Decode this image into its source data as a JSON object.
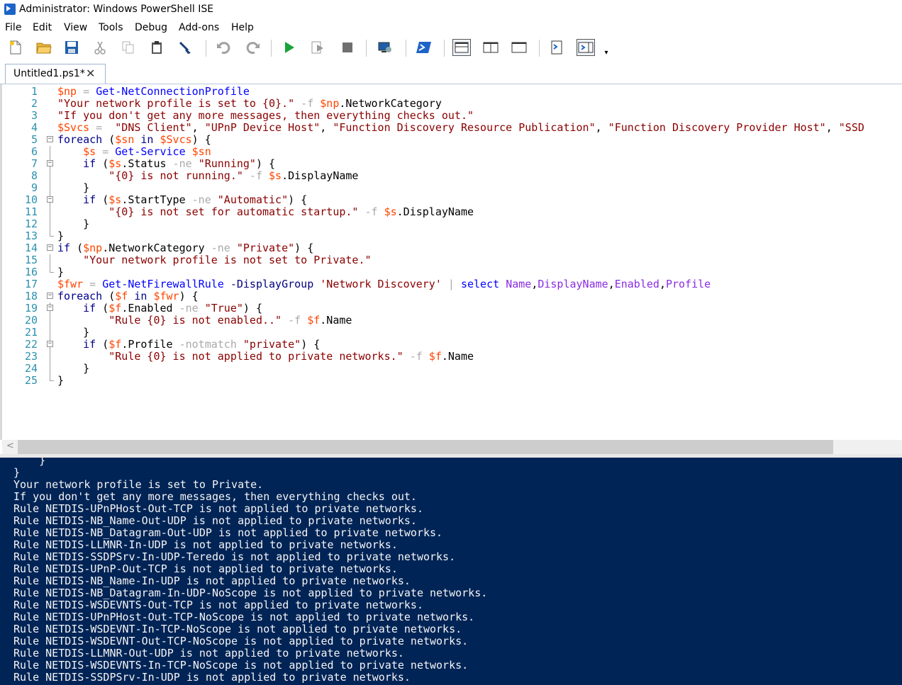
{
  "window": {
    "title": "Administrator: Windows PowerShell ISE"
  },
  "menu": [
    "File",
    "Edit",
    "View",
    "Tools",
    "Debug",
    "Add-ons",
    "Help"
  ],
  "toolbar": {
    "buttons": [
      "new-script",
      "open",
      "save",
      "cut",
      "copy",
      "paste",
      "clear-console",
      "undo",
      "redo",
      "run-script",
      "run-selection",
      "stop",
      "new-remote-tab",
      "start-powershell",
      "show-script-pane-top",
      "show-script-pane-right",
      "show-script-pane-maximized",
      "show-command-window",
      "show-command-add-on"
    ]
  },
  "tab": {
    "label": "Untitled1.ps1*",
    "close": "✕"
  },
  "editor": {
    "lines": [
      [
        [
          "$np",
          "var"
        ],
        [
          " = ",
          "op"
        ],
        [
          "Get-NetConnectionProfile",
          "cmd"
        ]
      ],
      [
        [
          "\"Your network profile is set to {0}.\"",
          "str"
        ],
        [
          " -f ",
          "op"
        ],
        [
          "$np",
          "var"
        ],
        [
          ".NetworkCategory",
          "mem"
        ]
      ],
      [
        [
          "\"If you don't get any more messages, then everything checks out.\"",
          "str"
        ]
      ],
      [
        [
          "$Svcs",
          "var"
        ],
        [
          " =  ",
          "op"
        ],
        [
          "\"DNS Client\"",
          "str"
        ],
        [
          ", ",
          "par"
        ],
        [
          "\"UPnP Device Host\"",
          "str"
        ],
        [
          ", ",
          "par"
        ],
        [
          "\"Function Discovery Resource Publication\"",
          "str"
        ],
        [
          ", ",
          "par"
        ],
        [
          "\"Function Discovery Provider Host\"",
          "str"
        ],
        [
          ", ",
          "par"
        ],
        [
          "\"SSD",
          "str"
        ]
      ],
      [
        [
          "foreach",
          "kw"
        ],
        [
          " (",
          "par"
        ],
        [
          "$sn",
          "var"
        ],
        [
          " in ",
          "kw"
        ],
        [
          "$Svcs",
          "var"
        ],
        [
          ") {",
          "par"
        ]
      ],
      [
        [
          "    ",
          "plain"
        ],
        [
          "$s",
          "var"
        ],
        [
          " = ",
          "op"
        ],
        [
          "Get-Service",
          "cmd"
        ],
        [
          " ",
          "plain"
        ],
        [
          "$sn",
          "var"
        ]
      ],
      [
        [
          "    ",
          "plain"
        ],
        [
          "if",
          "kw"
        ],
        [
          " (",
          "par"
        ],
        [
          "$s",
          "var"
        ],
        [
          ".Status",
          "mem"
        ],
        [
          " -ne ",
          "op"
        ],
        [
          "\"Running\"",
          "str"
        ],
        [
          ") {",
          "par"
        ]
      ],
      [
        [
          "        ",
          "plain"
        ],
        [
          "\"{0} is not running.\"",
          "str"
        ],
        [
          " -f ",
          "op"
        ],
        [
          "$s",
          "var"
        ],
        [
          ".DisplayName",
          "mem"
        ]
      ],
      [
        [
          "    }",
          "par"
        ]
      ],
      [
        [
          "    ",
          "plain"
        ],
        [
          "if",
          "kw"
        ],
        [
          " (",
          "par"
        ],
        [
          "$s",
          "var"
        ],
        [
          ".StartType",
          "mem"
        ],
        [
          " -ne ",
          "op"
        ],
        [
          "\"Automatic\"",
          "str"
        ],
        [
          ") {",
          "par"
        ]
      ],
      [
        [
          "        ",
          "plain"
        ],
        [
          "\"{0} is not set for automatic startup.\"",
          "str"
        ],
        [
          " -f ",
          "op"
        ],
        [
          "$s",
          "var"
        ],
        [
          ".DisplayName",
          "mem"
        ]
      ],
      [
        [
          "    }",
          "par"
        ]
      ],
      [
        [
          "}",
          "par"
        ]
      ],
      [
        [
          "if",
          "kw"
        ],
        [
          " (",
          "par"
        ],
        [
          "$np",
          "var"
        ],
        [
          ".NetworkCategory",
          "mem"
        ],
        [
          " -ne ",
          "op"
        ],
        [
          "\"Private\"",
          "str"
        ],
        [
          ") {",
          "par"
        ]
      ],
      [
        [
          "    ",
          "plain"
        ],
        [
          "\"Your network profile is not set to Private.\"",
          "str"
        ]
      ],
      [
        [
          "}",
          "par"
        ]
      ],
      [
        [
          "$fwr",
          "var"
        ],
        [
          " = ",
          "op"
        ],
        [
          "Get-NetFirewallRule",
          "cmd"
        ],
        [
          " -DisplayGroup ",
          "cparam"
        ],
        [
          "'Network Discovery'",
          "str"
        ],
        [
          " | ",
          "op"
        ],
        [
          "select",
          "cmd"
        ],
        [
          " ",
          "plain"
        ],
        [
          "Name",
          "arg"
        ],
        [
          ",",
          "par"
        ],
        [
          "DisplayName",
          "arg"
        ],
        [
          ",",
          "par"
        ],
        [
          "Enabled",
          "arg"
        ],
        [
          ",",
          "par"
        ],
        [
          "Profile",
          "arg"
        ]
      ],
      [
        [
          "foreach",
          "kw"
        ],
        [
          " (",
          "par"
        ],
        [
          "$f",
          "var"
        ],
        [
          " in ",
          "kw"
        ],
        [
          "$fwr",
          "var"
        ],
        [
          ") {",
          "par"
        ]
      ],
      [
        [
          "    ",
          "plain"
        ],
        [
          "if",
          "kw"
        ],
        [
          " (",
          "par"
        ],
        [
          "$f",
          "var"
        ],
        [
          ".Enabled",
          "mem"
        ],
        [
          " -ne ",
          "op"
        ],
        [
          "\"True\"",
          "str"
        ],
        [
          ") {",
          "par"
        ]
      ],
      [
        [
          "        ",
          "plain"
        ],
        [
          "\"Rule {0} is not enabled..\"",
          "str"
        ],
        [
          " -f ",
          "op"
        ],
        [
          "$f",
          "var"
        ],
        [
          ".Name",
          "mem"
        ]
      ],
      [
        [
          "    }",
          "par"
        ]
      ],
      [
        [
          "    ",
          "plain"
        ],
        [
          "if",
          "kw"
        ],
        [
          " (",
          "par"
        ],
        [
          "$f",
          "var"
        ],
        [
          ".Profile",
          "mem"
        ],
        [
          " -notmatch ",
          "op"
        ],
        [
          "\"private\"",
          "str"
        ],
        [
          ") {",
          "par"
        ]
      ],
      [
        [
          "        ",
          "plain"
        ],
        [
          "\"Rule {0} is not applied to private networks.\"",
          "str"
        ],
        [
          " -f ",
          "op"
        ],
        [
          "$f",
          "var"
        ],
        [
          ".Name",
          "mem"
        ]
      ],
      [
        [
          "    }",
          "par"
        ]
      ],
      [
        [
          "}",
          "par"
        ]
      ]
    ]
  },
  "console": {
    "lines": [
      "    }",
      "}",
      "Your network profile is set to Private.",
      "If you don't get any more messages, then everything checks out.",
      "Rule NETDIS-UPnPHost-Out-TCP is not applied to private networks.",
      "Rule NETDIS-NB_Name-Out-UDP is not applied to private networks.",
      "Rule NETDIS-NB_Datagram-Out-UDP is not applied to private networks.",
      "Rule NETDIS-LLMNR-In-UDP is not applied to private networks.",
      "Rule NETDIS-SSDPSrv-In-UDP-Teredo is not applied to private networks.",
      "Rule NETDIS-UPnP-Out-TCP is not applied to private networks.",
      "Rule NETDIS-NB_Name-In-UDP is not applied to private networks.",
      "Rule NETDIS-NB_Datagram-In-UDP-NoScope is not applied to private networks.",
      "Rule NETDIS-WSDEVNTS-Out-TCP is not applied to private networks.",
      "Rule NETDIS-UPnPHost-Out-TCP-NoScope is not applied to private networks.",
      "Rule NETDIS-WSDEVNT-In-TCP-NoScope is not applied to private networks.",
      "Rule NETDIS-WSDEVNT-Out-TCP-NoScope is not applied to private networks.",
      "Rule NETDIS-LLMNR-Out-UDP is not applied to private networks.",
      "Rule NETDIS-WSDEVNTS-In-TCP-NoScope is not applied to private networks.",
      "Rule NETDIS-SSDPSrv-In-UDP is not applied to private networks."
    ]
  },
  "colors": {
    "console_bg": "#012456",
    "line_number": "#2b91af",
    "variable": "#ff4500",
    "command": "#0000ff",
    "string": "#8b0000",
    "keyword": "#00008b"
  }
}
